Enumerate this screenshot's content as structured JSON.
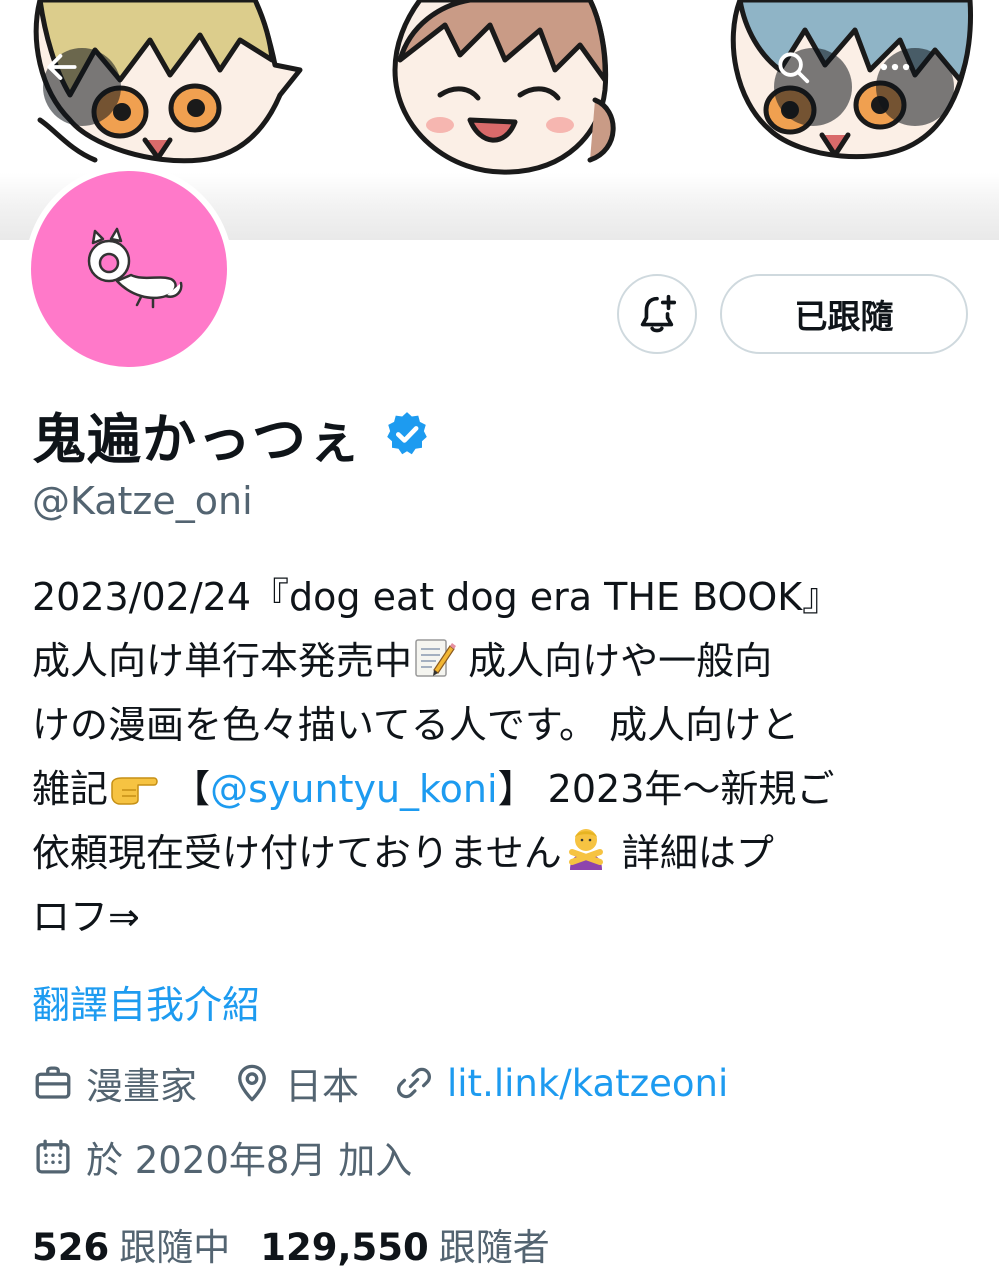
{
  "profile": {
    "display_name": "鬼遍かっつぇ",
    "handle": "@Katze_oni",
    "verified": true,
    "follow_button_label": "已跟隨"
  },
  "bio": {
    "line1": "2023/02/24『dog eat dog era THE BOOK』",
    "line2_a": "成人向け単行本発売中",
    "line2_b": " 成人向けや一般向",
    "line3": "けの漫画を色々描いてる人です。 成人向けと",
    "line4_a": "雑記",
    "line4_b": " 【",
    "line4_mention": "@syuntyu_koni",
    "line4_c": "】 2023年～新規ご",
    "line5_a": "依頼現在受け付けておりません",
    "line5_b": " 詳細はプ",
    "line6": "ロフ⇒"
  },
  "translate_label": "翻譯自我介紹",
  "meta": {
    "profession": "漫畫家",
    "location": "日本",
    "link": "lit.link/katzeoni",
    "joined": "於 2020年8月 加入"
  },
  "stats": {
    "following_count": "526",
    "following_label": "跟隨中",
    "followers_count": "129,550",
    "followers_label": "跟隨者"
  },
  "icons": {
    "back": "arrow-left-icon",
    "search": "search-icon",
    "more": "more-icon",
    "bell": "bell-plus-icon",
    "verified": "verified-badge-icon",
    "profession": "briefcase-icon",
    "location": "location-pin-icon",
    "link": "link-icon",
    "joined": "calendar-icon"
  },
  "colors": {
    "accent": "#1d9bf0",
    "secondary_text": "#536471",
    "avatar_bg": "#ff79c9"
  }
}
